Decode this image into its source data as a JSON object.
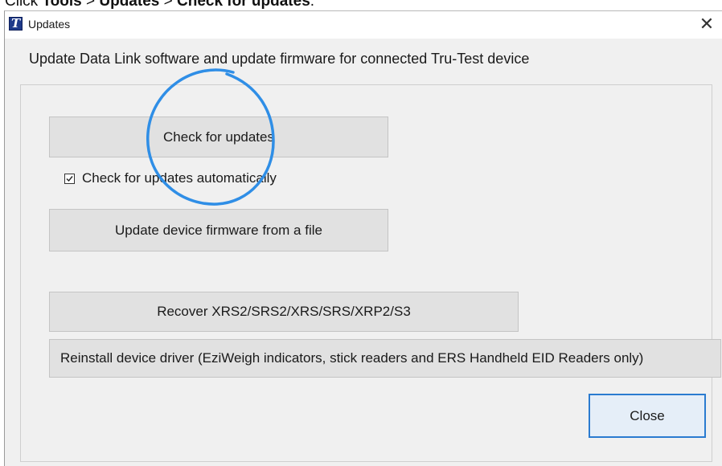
{
  "caption": {
    "prefix": "Click ",
    "tools": "Tools",
    "sep1": " > ",
    "updates": "Updates",
    "sep2": " > ",
    "check": "Check for updates",
    "suffix": "."
  },
  "window": {
    "title": "Updates",
    "close_glyph": "✕",
    "icon_letter": "T"
  },
  "description": "Update Data Link software and update firmware for connected Tru-Test device",
  "buttons": {
    "check_updates": "Check for updates",
    "update_firmware": "Update device firmware from a file",
    "recover": "Recover XRS2/SRS2/XRS/SRS/XRP2/S3",
    "reinstall_driver": "Reinstall device driver (EziWeigh indicators, stick readers and ERS Handheld EID Readers only)",
    "close": "Close"
  },
  "auto_check": {
    "label": "Check for updates automatically",
    "checked": true
  },
  "colors": {
    "annotation": "#2f8ee6",
    "focus_border": "#2a7bd0",
    "button_bg": "#e1e1e1",
    "dialog_bg": "#f0f0f0"
  },
  "icons": {
    "app": "tru-test-logo-icon",
    "close": "close-icon",
    "checkbox": "checkmark-icon"
  }
}
